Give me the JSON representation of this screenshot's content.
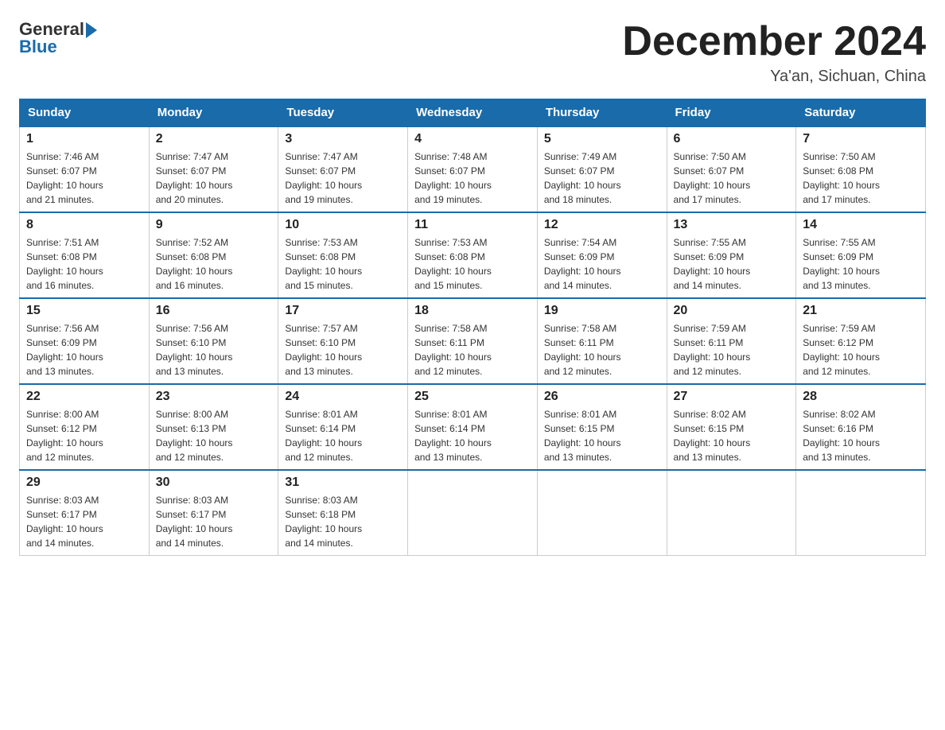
{
  "header": {
    "logo_general": "General",
    "logo_blue": "Blue",
    "month_title": "December 2024",
    "subtitle": "Ya'an, Sichuan, China"
  },
  "days_of_week": [
    "Sunday",
    "Monday",
    "Tuesday",
    "Wednesday",
    "Thursday",
    "Friday",
    "Saturday"
  ],
  "weeks": [
    [
      {
        "day": "1",
        "sunrise": "7:46 AM",
        "sunset": "6:07 PM",
        "daylight": "10 hours and 21 minutes."
      },
      {
        "day": "2",
        "sunrise": "7:47 AM",
        "sunset": "6:07 PM",
        "daylight": "10 hours and 20 minutes."
      },
      {
        "day": "3",
        "sunrise": "7:47 AM",
        "sunset": "6:07 PM",
        "daylight": "10 hours and 19 minutes."
      },
      {
        "day": "4",
        "sunrise": "7:48 AM",
        "sunset": "6:07 PM",
        "daylight": "10 hours and 19 minutes."
      },
      {
        "day": "5",
        "sunrise": "7:49 AM",
        "sunset": "6:07 PM",
        "daylight": "10 hours and 18 minutes."
      },
      {
        "day": "6",
        "sunrise": "7:50 AM",
        "sunset": "6:07 PM",
        "daylight": "10 hours and 17 minutes."
      },
      {
        "day": "7",
        "sunrise": "7:50 AM",
        "sunset": "6:08 PM",
        "daylight": "10 hours and 17 minutes."
      }
    ],
    [
      {
        "day": "8",
        "sunrise": "7:51 AM",
        "sunset": "6:08 PM",
        "daylight": "10 hours and 16 minutes."
      },
      {
        "day": "9",
        "sunrise": "7:52 AM",
        "sunset": "6:08 PM",
        "daylight": "10 hours and 16 minutes."
      },
      {
        "day": "10",
        "sunrise": "7:53 AM",
        "sunset": "6:08 PM",
        "daylight": "10 hours and 15 minutes."
      },
      {
        "day": "11",
        "sunrise": "7:53 AM",
        "sunset": "6:08 PM",
        "daylight": "10 hours and 15 minutes."
      },
      {
        "day": "12",
        "sunrise": "7:54 AM",
        "sunset": "6:09 PM",
        "daylight": "10 hours and 14 minutes."
      },
      {
        "day": "13",
        "sunrise": "7:55 AM",
        "sunset": "6:09 PM",
        "daylight": "10 hours and 14 minutes."
      },
      {
        "day": "14",
        "sunrise": "7:55 AM",
        "sunset": "6:09 PM",
        "daylight": "10 hours and 13 minutes."
      }
    ],
    [
      {
        "day": "15",
        "sunrise": "7:56 AM",
        "sunset": "6:09 PM",
        "daylight": "10 hours and 13 minutes."
      },
      {
        "day": "16",
        "sunrise": "7:56 AM",
        "sunset": "6:10 PM",
        "daylight": "10 hours and 13 minutes."
      },
      {
        "day": "17",
        "sunrise": "7:57 AM",
        "sunset": "6:10 PM",
        "daylight": "10 hours and 13 minutes."
      },
      {
        "day": "18",
        "sunrise": "7:58 AM",
        "sunset": "6:11 PM",
        "daylight": "10 hours and 12 minutes."
      },
      {
        "day": "19",
        "sunrise": "7:58 AM",
        "sunset": "6:11 PM",
        "daylight": "10 hours and 12 minutes."
      },
      {
        "day": "20",
        "sunrise": "7:59 AM",
        "sunset": "6:11 PM",
        "daylight": "10 hours and 12 minutes."
      },
      {
        "day": "21",
        "sunrise": "7:59 AM",
        "sunset": "6:12 PM",
        "daylight": "10 hours and 12 minutes."
      }
    ],
    [
      {
        "day": "22",
        "sunrise": "8:00 AM",
        "sunset": "6:12 PM",
        "daylight": "10 hours and 12 minutes."
      },
      {
        "day": "23",
        "sunrise": "8:00 AM",
        "sunset": "6:13 PM",
        "daylight": "10 hours and 12 minutes."
      },
      {
        "day": "24",
        "sunrise": "8:01 AM",
        "sunset": "6:14 PM",
        "daylight": "10 hours and 12 minutes."
      },
      {
        "day": "25",
        "sunrise": "8:01 AM",
        "sunset": "6:14 PM",
        "daylight": "10 hours and 13 minutes."
      },
      {
        "day": "26",
        "sunrise": "8:01 AM",
        "sunset": "6:15 PM",
        "daylight": "10 hours and 13 minutes."
      },
      {
        "day": "27",
        "sunrise": "8:02 AM",
        "sunset": "6:15 PM",
        "daylight": "10 hours and 13 minutes."
      },
      {
        "day": "28",
        "sunrise": "8:02 AM",
        "sunset": "6:16 PM",
        "daylight": "10 hours and 13 minutes."
      }
    ],
    [
      {
        "day": "29",
        "sunrise": "8:03 AM",
        "sunset": "6:17 PM",
        "daylight": "10 hours and 14 minutes."
      },
      {
        "day": "30",
        "sunrise": "8:03 AM",
        "sunset": "6:17 PM",
        "daylight": "10 hours and 14 minutes."
      },
      {
        "day": "31",
        "sunrise": "8:03 AM",
        "sunset": "6:18 PM",
        "daylight": "10 hours and 14 minutes."
      },
      null,
      null,
      null,
      null
    ]
  ],
  "labels": {
    "sunrise": "Sunrise:",
    "sunset": "Sunset:",
    "daylight": "Daylight:"
  }
}
